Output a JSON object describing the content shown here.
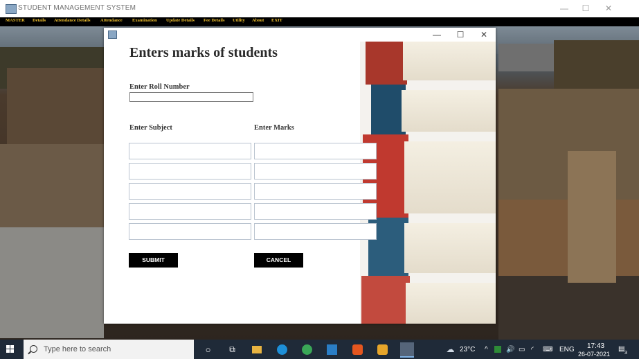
{
  "main_window": {
    "title": "STUDENT MANAGEMENT SYSTEM",
    "controls": {
      "minimize": "—",
      "maximize": "☐",
      "close": "✕"
    }
  },
  "menu": {
    "items": [
      "MASTER",
      "Details",
      "Attendance Details",
      "Attendance",
      "Examination",
      "Update Details",
      "Fee Details",
      "Utility",
      "About",
      "EXIT"
    ]
  },
  "child_window": {
    "controls": {
      "minimize": "—",
      "maximize": "☐",
      "close": "✕"
    },
    "heading": "Enters marks of students",
    "roll_label": "Enter Roll Number",
    "roll_value": "",
    "subject_label": "Enter Subject",
    "marks_label": "Enter Marks",
    "rows": [
      {
        "subject": "",
        "marks": ""
      },
      {
        "subject": "",
        "marks": ""
      },
      {
        "subject": "",
        "marks": ""
      },
      {
        "subject": "",
        "marks": ""
      },
      {
        "subject": "",
        "marks": ""
      }
    ],
    "submit_label": "SUBMIT",
    "cancel_label": "CANCEL"
  },
  "taskbar": {
    "search_placeholder": "Type here to search",
    "weather": "23°C",
    "language": "ENG",
    "time": "17:43",
    "date": "26-07-2021",
    "notification_count": "3"
  }
}
